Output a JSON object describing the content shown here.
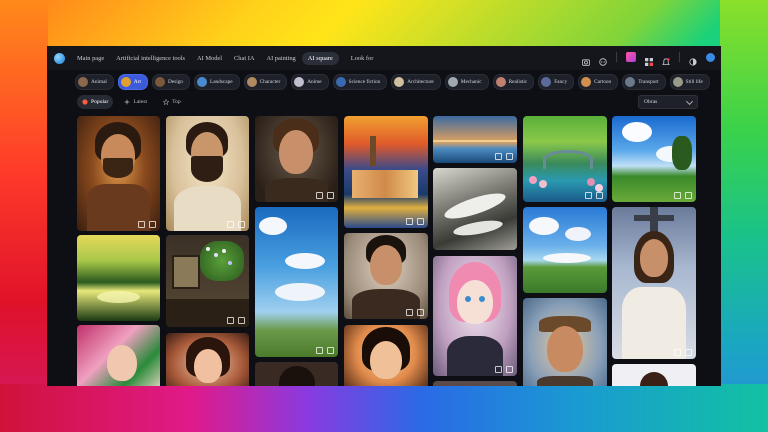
{
  "nav": {
    "items": [
      "Main page",
      "Artificial intelligence tools",
      "AI Model",
      "Chat IA",
      "AI painting",
      "AI square",
      "Look for"
    ],
    "active_index": 5
  },
  "toolbar_icons": [
    "camera-icon",
    "discord-icon",
    "gift-icon",
    "apps-grid-icon",
    "bell-icon",
    "theme-toggle-icon",
    "avatar"
  ],
  "categories": [
    {
      "label": "Animal",
      "color": "#8a6a4a"
    },
    {
      "label": "Art",
      "color": "#e0a030",
      "selected": true
    },
    {
      "label": "Design",
      "color": "#7a5a3a"
    },
    {
      "label": "Landscape",
      "color": "#4a8ad0"
    },
    {
      "label": "Character",
      "color": "#b08a60"
    },
    {
      "label": "Anime",
      "color": "#c0c0d0"
    },
    {
      "label": "Science fiction",
      "color": "#3a6ab0"
    },
    {
      "label": "Architecture",
      "color": "#d0c0a0"
    },
    {
      "label": "Mechanic",
      "color": "#a0a8b0"
    },
    {
      "label": "Realistic",
      "color": "#c08070"
    },
    {
      "label": "Fancy",
      "color": "#5a6a9a"
    },
    {
      "label": "Cartoon",
      "color": "#d09050"
    },
    {
      "label": "Transport",
      "color": "#6a7a8a"
    },
    {
      "label": "Still life",
      "color": "#9a9a8a"
    }
  ],
  "sort": {
    "items": [
      "Popular",
      "Latest",
      "Top"
    ],
    "selected": 0
  },
  "filter": {
    "value": "Obras"
  },
  "gallery_counts": {
    "c1": "1",
    "c4": "1",
    "c13": "2"
  }
}
